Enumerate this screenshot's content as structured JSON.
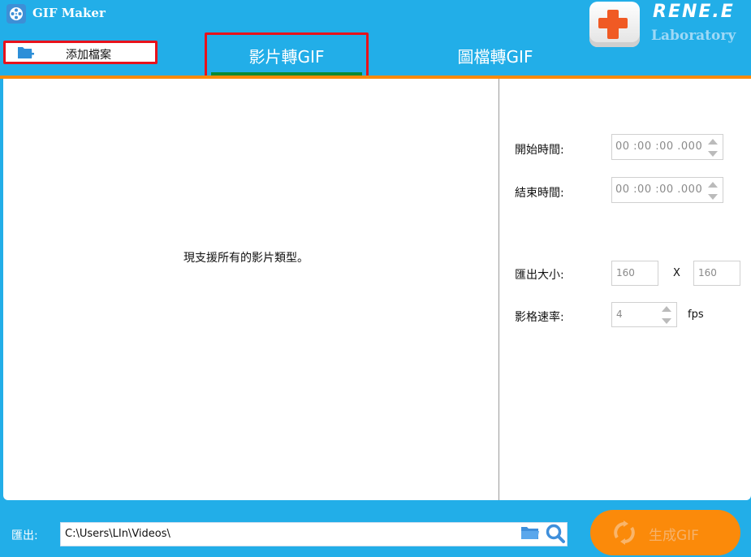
{
  "app": {
    "title": "GIF Maker"
  },
  "toolbar": {
    "add_file_label": "添加檔案"
  },
  "tabs": [
    {
      "label": "影片轉GIF",
      "active": true
    },
    {
      "label": "圖檔轉GIF",
      "active": false
    }
  ],
  "logo": {
    "name": "RENE.E",
    "sub": "Laboratory"
  },
  "main": {
    "drop_hint": "現支援所有的影片類型。"
  },
  "settings": {
    "start_time_label": "開始時間:",
    "start_time_value": "00 :00 :00 .000",
    "end_time_label": "結束時間:",
    "end_time_value": "00 :00 :00 .000",
    "output_size_label": "匯出大小:",
    "width_value": "160",
    "size_separator": "X",
    "height_value": "160",
    "frame_rate_label": "影格速率:",
    "frame_rate_value": "4",
    "frame_rate_unit": "fps"
  },
  "footer": {
    "output_label": "匯出:",
    "output_path": "C:\\Users\\LIn\\Videos\\",
    "generate_label": "生成GIF"
  },
  "colors": {
    "primary": "#22aee8",
    "accent": "#fb8a0a",
    "highlight": "#e8121b",
    "active_tab": "#0a8a33"
  }
}
